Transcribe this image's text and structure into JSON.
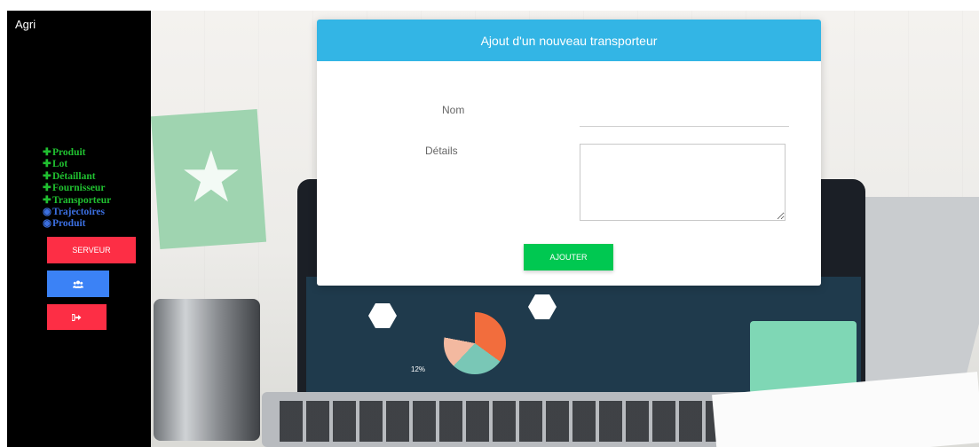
{
  "sidebar": {
    "brand": "Agri",
    "menu": [
      {
        "icon": "plus-icon",
        "label": "Produit",
        "kind": "add"
      },
      {
        "icon": "plus-icon",
        "label": "Lot",
        "kind": "add"
      },
      {
        "icon": "plus-icon",
        "label": "Détaillant",
        "kind": "add"
      },
      {
        "icon": "plus-icon",
        "label": "Fournisseur",
        "kind": "add"
      },
      {
        "icon": "plus-icon",
        "label": "Transporteur",
        "kind": "add"
      },
      {
        "icon": "eye-icon",
        "label": "Trajectoires",
        "kind": "view"
      },
      {
        "icon": "eye-icon",
        "label": "Produit",
        "kind": "view"
      }
    ],
    "server_button": "SERVEUR",
    "users_button_icon": "users-icon",
    "logout_button_icon": "sign-out-icon"
  },
  "modal": {
    "title": "Ajout d'un nouveau transporteur",
    "nom_label": "Nom",
    "nom_value": "",
    "details_label": "Détails",
    "details_value": "",
    "submit_label": "AJOUTER"
  },
  "background": {
    "screen_percent_text": "12%"
  },
  "colors": {
    "sidebar_bg": "#000000",
    "add_green": "#20c030",
    "view_blue": "#3b6fe0",
    "red_button": "#fd2e45",
    "blue_button": "#3b82f6",
    "modal_header": "#33b5e5",
    "submit_green": "#00c851"
  }
}
